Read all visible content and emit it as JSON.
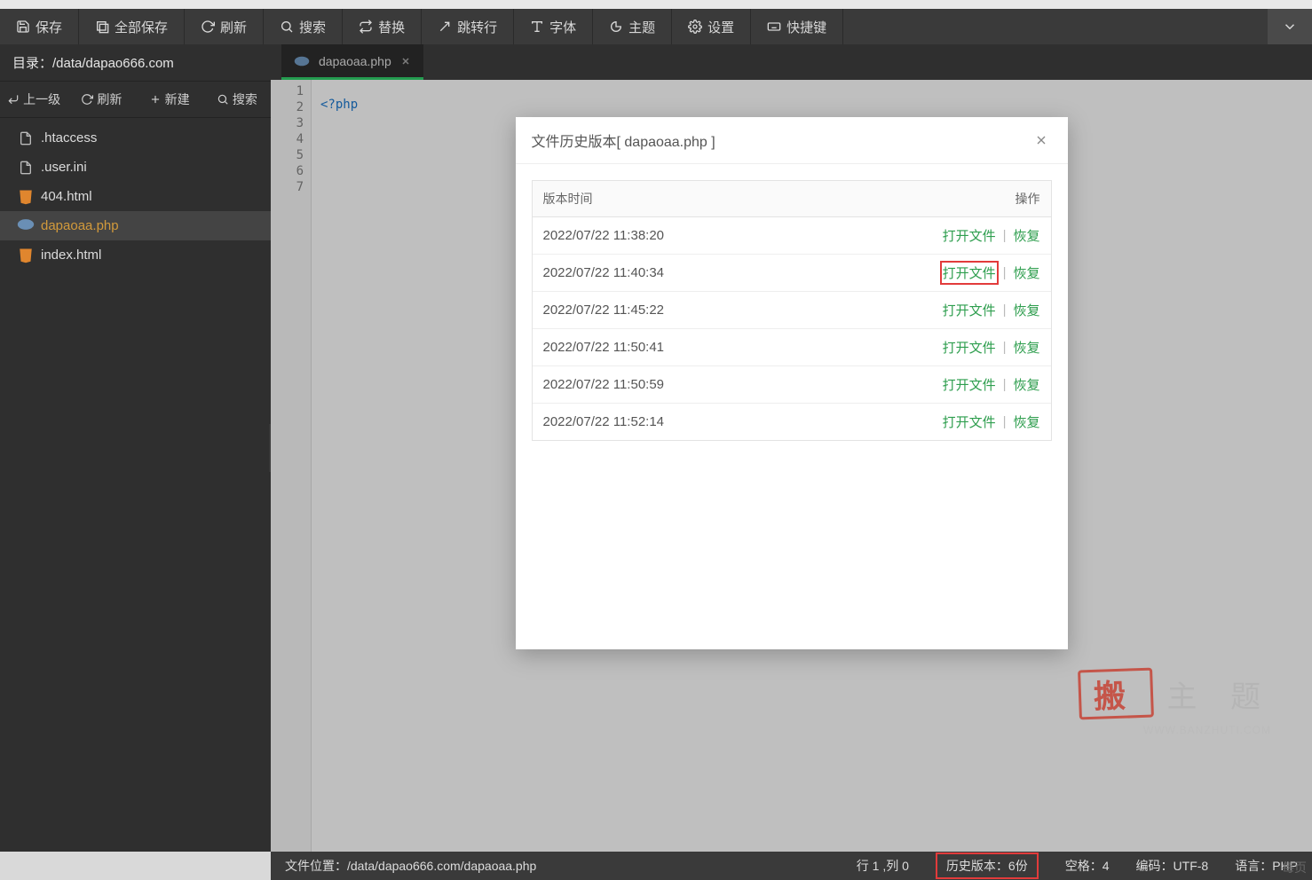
{
  "toolbar": {
    "items": [
      {
        "label": "保存",
        "name": "save-button"
      },
      {
        "label": "全部保存",
        "name": "save-all-button"
      },
      {
        "label": "刷新",
        "name": "refresh-button"
      },
      {
        "label": "搜索",
        "name": "search-button"
      },
      {
        "label": "替换",
        "name": "replace-button"
      },
      {
        "label": "跳转行",
        "name": "goto-line-button"
      },
      {
        "label": "字体",
        "name": "font-button"
      },
      {
        "label": "主题",
        "name": "theme-button"
      },
      {
        "label": "设置",
        "name": "settings-button"
      },
      {
        "label": "快捷键",
        "name": "shortcuts-button"
      }
    ]
  },
  "sidebar": {
    "dir_label_prefix": "目录：",
    "dir_path": "/data/dapao666.com",
    "actions": {
      "up": "上一级",
      "refresh": "刷新",
      "new": "新建",
      "search": "搜索"
    },
    "files": [
      {
        "name": ".htaccess",
        "icon": "file"
      },
      {
        "name": ".user.ini",
        "icon": "file"
      },
      {
        "name": "404.html",
        "icon": "html"
      },
      {
        "name": "dapaoaa.php",
        "icon": "php",
        "active": true
      },
      {
        "name": "index.html",
        "icon": "html"
      }
    ]
  },
  "tabs": [
    {
      "label": "dapaoaa.php",
      "icon": "php"
    }
  ],
  "code": {
    "gutter": [
      "1",
      "2",
      "3",
      "4",
      "5",
      "6",
      "7"
    ],
    "line2": "<?php"
  },
  "dialog": {
    "title": "文件历史版本[ dapaoaa.php ]",
    "col_time": "版本时间",
    "col_ops": "操作",
    "open_label": "打开文件",
    "restore_label": "恢复",
    "rows": [
      {
        "time": "2022/07/22 11:38:20"
      },
      {
        "time": "2022/07/22 11:40:34",
        "highlight": true
      },
      {
        "time": "2022/07/22 11:45:22"
      },
      {
        "time": "2022/07/22 11:50:41"
      },
      {
        "time": "2022/07/22 11:50:59"
      },
      {
        "time": "2022/07/22 11:52:14"
      }
    ]
  },
  "status": {
    "loc_prefix": "文件位置：",
    "loc_path": "/data/dapao666.com/dapaoaa.php",
    "cursor": "行 1 ,列 0",
    "history": "历史版本：6份",
    "tab": "空格：4",
    "encoding": "编码：UTF-8",
    "lang": "语言：PHP"
  },
  "watermark": {
    "text": "主 题",
    "sub": "WWW.BANZHUTI.COM"
  },
  "bottom_right": "每页"
}
